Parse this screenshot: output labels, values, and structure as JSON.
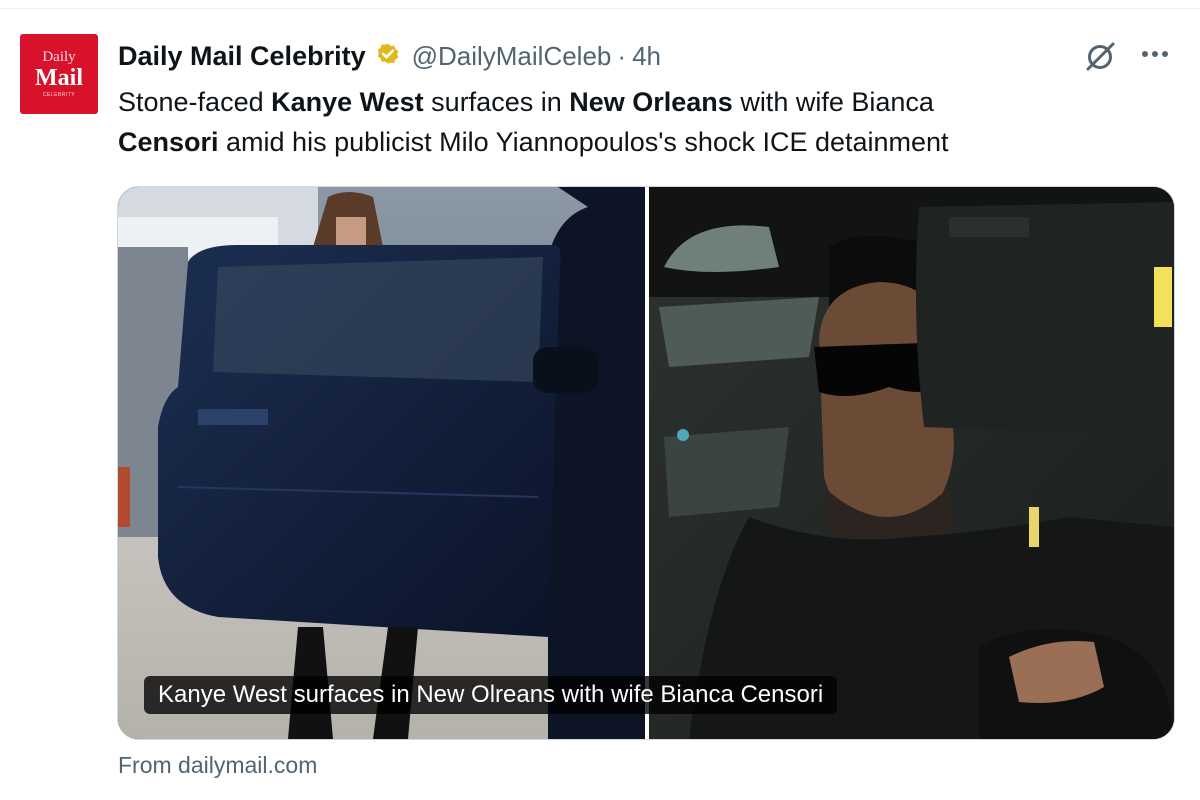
{
  "tweet": {
    "avatar": {
      "line1": "Daily",
      "line2": "Mail",
      "line3": "CELEBRITY"
    },
    "author_name": "Daily Mail Celebrity",
    "handle": "@DailyMailCeleb",
    "separator": "·",
    "time": "4h",
    "text_parts": [
      "Stone-faced ",
      "Kanye West",
      " surfaces in ",
      "New Orleans",
      " with wife Bianca ",
      "Censori",
      " amid his publicist Milo Yiannopoulos's shock ICE detainment"
    ],
    "media_caption": "Kanye West surfaces in New Olreans with wife Bianca Censori",
    "source": "From dailymail.com"
  },
  "colors": {
    "brand_red": "#d8122b",
    "verified_gold": "#e2b719",
    "secondary_text": "#536471"
  },
  "icons": [
    "verified-badge-icon",
    "grok-icon",
    "more-icon"
  ]
}
